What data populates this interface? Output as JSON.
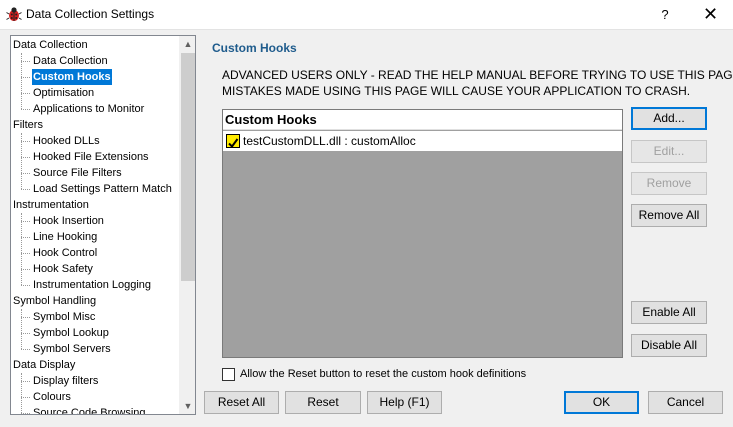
{
  "window": {
    "title": "Data Collection Settings",
    "help_glyph": "?",
    "close_glyph": "✕"
  },
  "tree": {
    "categories": [
      {
        "label": "Data Collection",
        "children": [
          "Data Collection",
          "Custom Hooks",
          "Optimisation",
          "Applications to Monitor"
        ]
      },
      {
        "label": "Filters",
        "children": [
          "Hooked DLLs",
          "Hooked File Extensions",
          "Source File Filters",
          "Load Settings Pattern Match"
        ]
      },
      {
        "label": "Instrumentation",
        "children": [
          "Hook Insertion",
          "Line Hooking",
          "Hook Control",
          "Hook Safety",
          "Instrumentation Logging"
        ]
      },
      {
        "label": "Symbol Handling",
        "children": [
          "Symbol Misc",
          "Symbol Lookup",
          "Symbol Servers"
        ]
      },
      {
        "label": "Data Display",
        "children": [
          "Display filters",
          "Colours",
          "Source Code Browsing"
        ]
      }
    ],
    "selected": "Custom Hooks"
  },
  "panel": {
    "title": "Custom Hooks",
    "warning_line1": "ADVANCED USERS ONLY - READ THE HELP MANUAL BEFORE TRYING TO USE THIS PAGE.",
    "warning_line2": "MISTAKES MADE USING THIS PAGE WILL CAUSE YOUR APPLICATION TO CRASH.",
    "list_header": "Custom Hooks",
    "hooks": [
      {
        "label": "testCustomDLL.dll : customAlloc",
        "checked": true
      }
    ],
    "reset_checkbox_label": "Allow the Reset button to reset the custom hook definitions",
    "reset_checkbox_checked": false
  },
  "side_buttons": {
    "add": "Add...",
    "edit": "Edit...",
    "remove": "Remove",
    "remove_all": "Remove All",
    "enable_all": "Enable All",
    "disable_all": "Disable All"
  },
  "footer_buttons": {
    "reset_all": "Reset All",
    "reset": "Reset",
    "help": "Help (F1)",
    "ok": "OK",
    "cancel": "Cancel"
  },
  "colors": {
    "selection": "#0078d7",
    "section_title": "#1e5b8c",
    "check_fill": "#ffeb00",
    "list_background": "#a0a0a0"
  }
}
